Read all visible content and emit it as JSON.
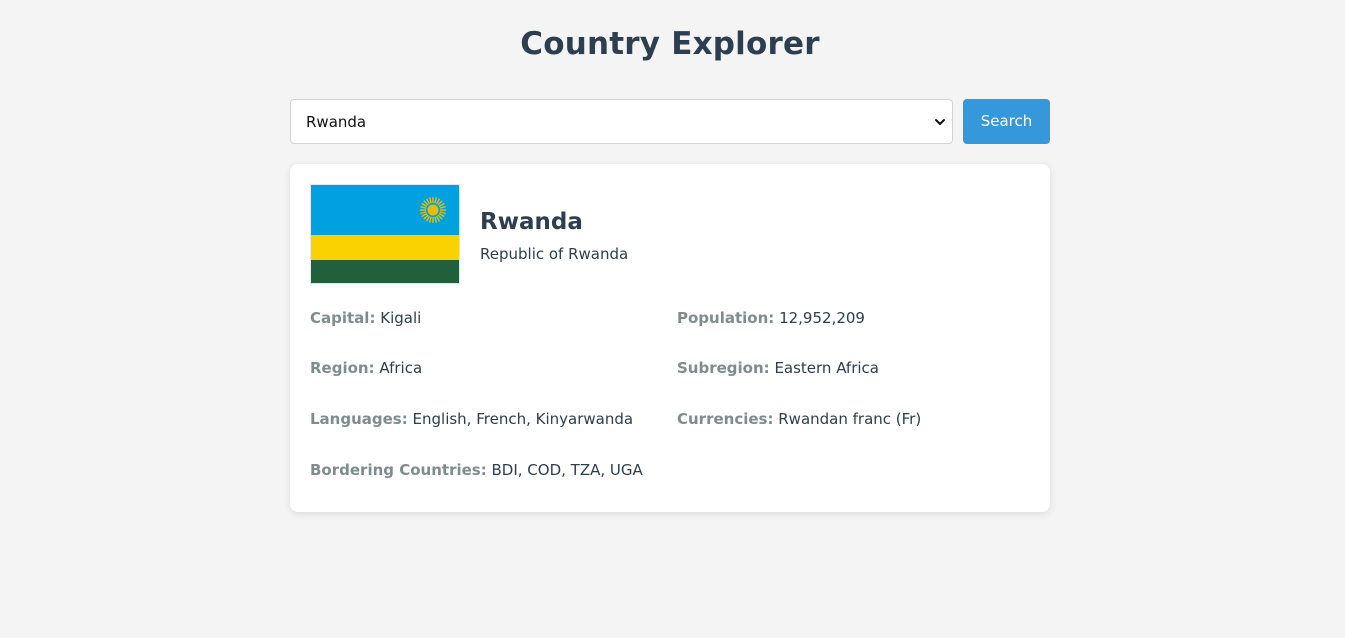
{
  "header": {
    "title": "Country Explorer"
  },
  "search": {
    "selected_country": "Rwanda",
    "button_label": "Search"
  },
  "country": {
    "name": "Rwanda",
    "official_name": "Republic of Rwanda",
    "flag_icon": "rwanda-flag",
    "flag_colors": {
      "sky_blue": "#00a1de",
      "sun": "#e5be01",
      "yellow": "#fad201",
      "green": "#20603d"
    },
    "fields": {
      "capital": {
        "label": "Capital:",
        "value": "Kigali"
      },
      "population": {
        "label": "Population:",
        "value": "12,952,209"
      },
      "region": {
        "label": "Region:",
        "value": "Africa"
      },
      "subregion": {
        "label": "Subregion:",
        "value": "Eastern Africa"
      },
      "languages": {
        "label": "Languages:",
        "value": "English, French, Kinyarwanda"
      },
      "currencies": {
        "label": "Currencies:",
        "value": "Rwandan franc (Fr)"
      },
      "borders": {
        "label": "Bordering Countries:",
        "value": "BDI, COD, TZA, UGA"
      }
    }
  },
  "theme": {
    "accent": "#3498db",
    "heading": "#2c3e50",
    "muted_label": "#7f8c8d",
    "background": "#f4f4f4"
  }
}
